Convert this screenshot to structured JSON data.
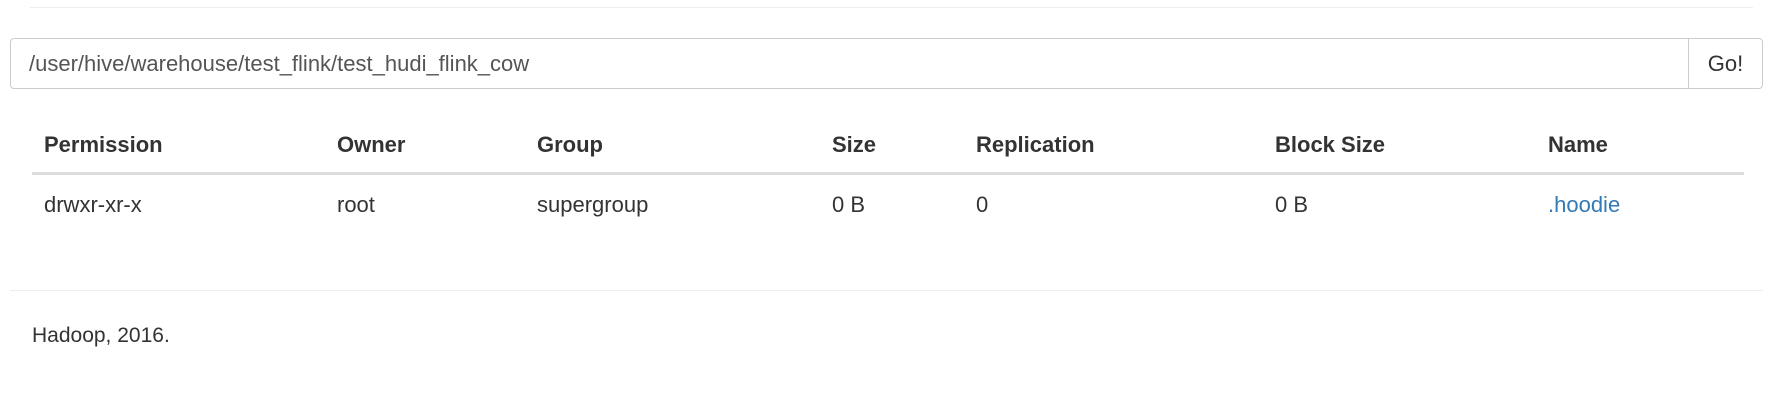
{
  "path_bar": {
    "value": "/user/hive/warehouse/test_flink/test_hudi_flink_cow",
    "go_label": "Go!"
  },
  "table": {
    "headers": [
      "Permission",
      "Owner",
      "Group",
      "Size",
      "Replication",
      "Block Size",
      "Name"
    ],
    "rows": [
      {
        "permission": "drwxr-xr-x",
        "owner": "root",
        "group": "supergroup",
        "size": "0 B",
        "replication": "0",
        "block_size": "0 B",
        "name": ".hoodie"
      }
    ]
  },
  "footer": {
    "text": "Hadoop, 2016."
  },
  "colors": {
    "link": "#337ab7",
    "text": "#333333",
    "border": "#cccccc"
  }
}
